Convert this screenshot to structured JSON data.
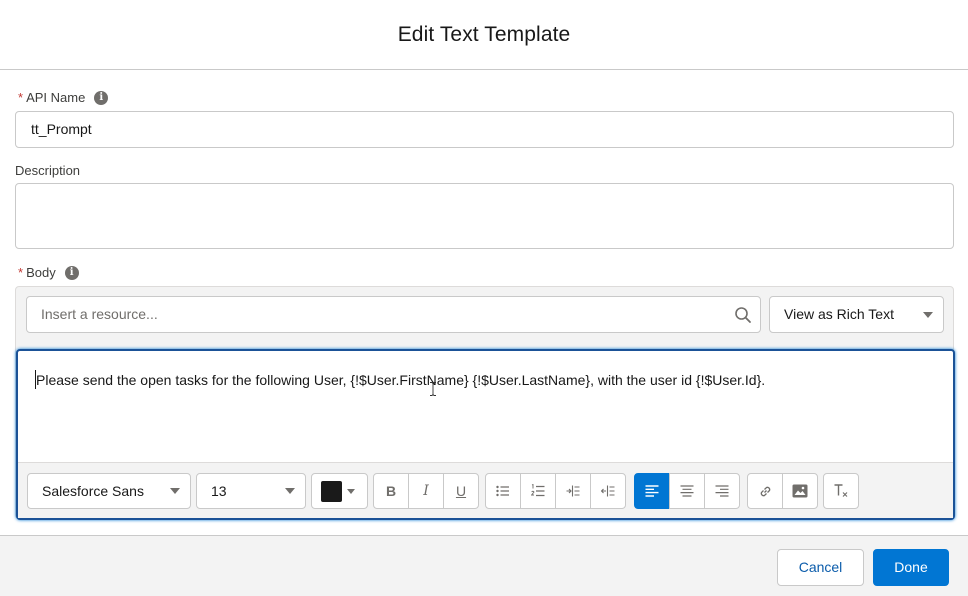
{
  "modal": {
    "title": "Edit Text Template"
  },
  "api_name": {
    "required_mark": "*",
    "label": "API Name",
    "value": "tt_Prompt"
  },
  "description": {
    "label": "Description",
    "value": ""
  },
  "body": {
    "required_mark": "*",
    "label": "Body",
    "resource_placeholder": "Insert a resource...",
    "view_mode": "View as Rich Text",
    "content": "Please send the open tasks for the following User, {!$User.FirstName} {!$User.LastName}, with the user id {!$User.Id}."
  },
  "toolbar": {
    "font_family": "Salesforce Sans",
    "font_size": "13",
    "text_color": "#1a1a1a",
    "bold": "B",
    "italic": "I",
    "underline": "U",
    "active_alignment": "align-left"
  },
  "footer": {
    "cancel_label": "Cancel",
    "done_label": "Done"
  },
  "colors": {
    "brand": "#0176d3",
    "focus_border": "#1b5297",
    "required": "#c23934"
  }
}
